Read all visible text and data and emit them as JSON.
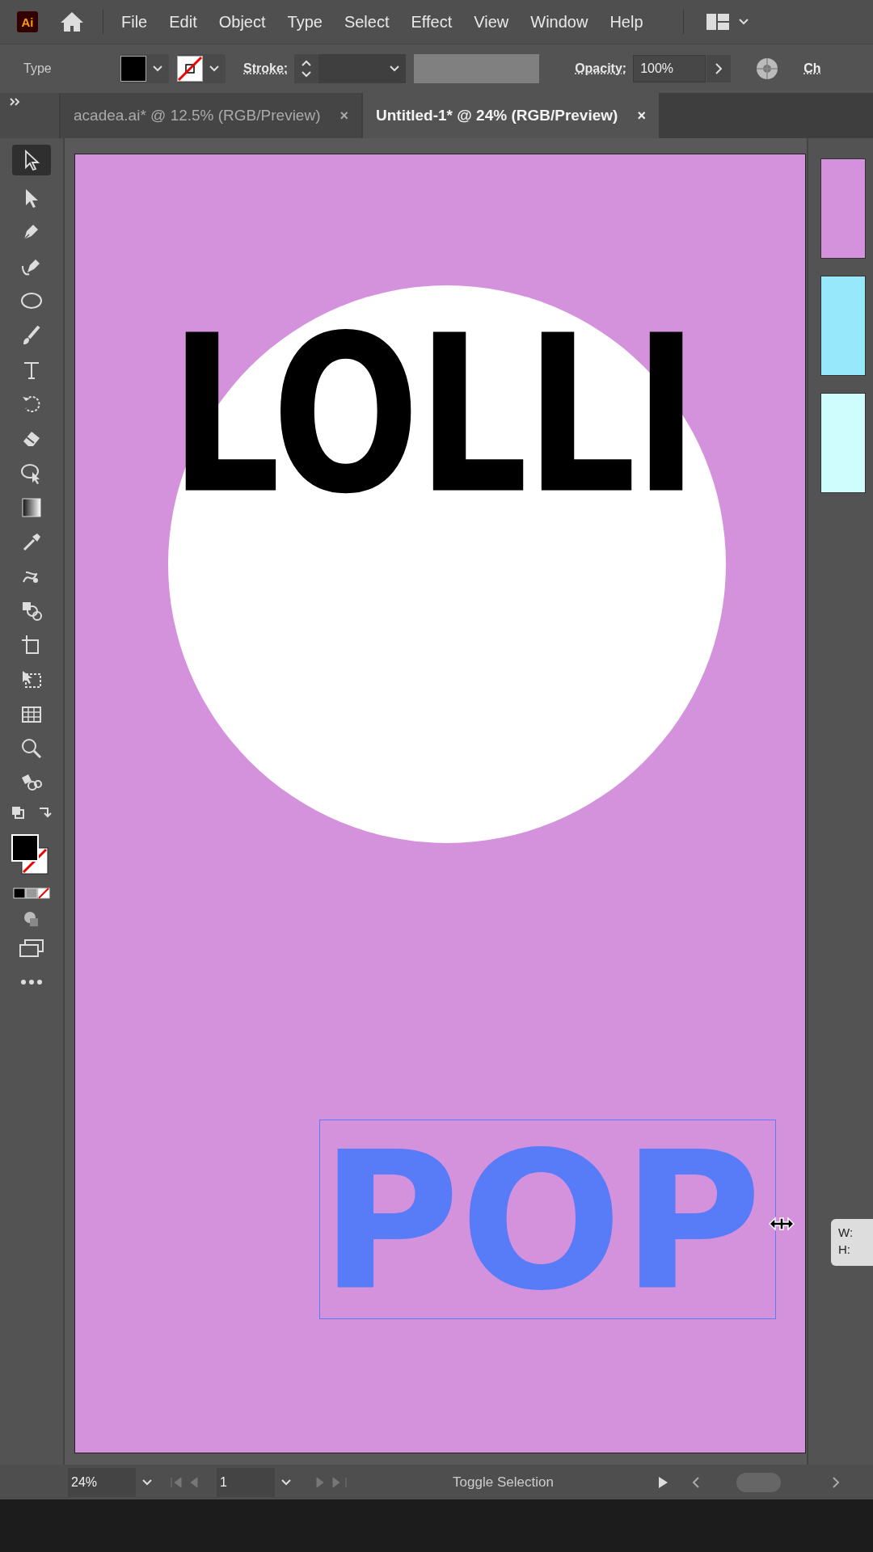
{
  "app_bar": {
    "logo": "Ai",
    "menu": [
      "File",
      "Edit",
      "Object",
      "Type",
      "Select",
      "Effect",
      "View",
      "Window",
      "Help"
    ]
  },
  "control_bar": {
    "label": "Type",
    "stroke_label": "Stroke:",
    "opacity_label": "Opacity:",
    "opacity_value": "100%",
    "cut_label": "Ch"
  },
  "tabs": [
    {
      "label": "acadea.ai* @ 12.5% (RGB/Preview)",
      "close": "×",
      "selected": false
    },
    {
      "label": "Untitled-1* @ 24% (RGB/Preview)",
      "close": "×",
      "selected": true
    }
  ],
  "tools": [
    {
      "kind": "selection",
      "selected": true
    },
    {
      "kind": "direct-selection",
      "selected": false
    },
    {
      "kind": "pen",
      "selected": false
    },
    {
      "kind": "curvature",
      "selected": false
    },
    {
      "kind": "ellipse",
      "selected": false
    },
    {
      "kind": "paintbrush",
      "selected": false
    },
    {
      "kind": "type",
      "selected": false
    },
    {
      "kind": "rotate",
      "selected": false
    },
    {
      "kind": "eraser",
      "selected": false
    },
    {
      "kind": "shape-builder",
      "selected": false
    },
    {
      "kind": "gradient",
      "selected": false
    },
    {
      "kind": "eyedropper",
      "selected": false
    },
    {
      "kind": "puppet-warp",
      "selected": false
    },
    {
      "kind": "symbol",
      "selected": false
    },
    {
      "kind": "artboard",
      "selected": false
    },
    {
      "kind": "free-transform",
      "selected": false
    },
    {
      "kind": "grid",
      "selected": false
    },
    {
      "kind": "zoom",
      "selected": false
    },
    {
      "kind": "blend",
      "selected": false
    }
  ],
  "artboard": {
    "headline": "LOLLI",
    "selected_text": "POP"
  },
  "swatches": [
    {
      "color": "#d592dc"
    },
    {
      "color": "#97e8fb"
    },
    {
      "color": "#cffcfd"
    }
  ],
  "tooltip": {
    "width_label": "W:",
    "height_label": "H:"
  },
  "status_bar": {
    "zoom": "24%",
    "page": "1",
    "status": "Toggle Selection"
  }
}
